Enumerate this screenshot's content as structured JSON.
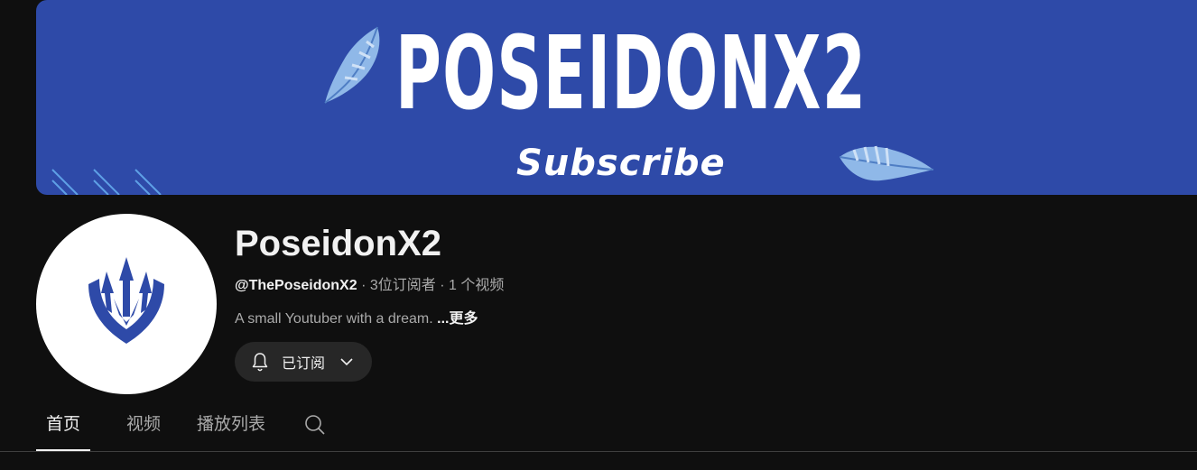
{
  "banner": {
    "title": "POSEIDONX2",
    "subtitle": "Subscribe",
    "background_color": "#2e4aa8"
  },
  "avatar": {
    "icon": "trident-crest-icon",
    "color": "#2e4aa8"
  },
  "channel": {
    "name": "PoseidonX2",
    "handle": "@ThePoseidonX2",
    "separator": " · ",
    "subscribers": "3位订阅者",
    "videos": "1 个视频",
    "description": "A small Youtuber with a dream. ",
    "more_label": "...更多"
  },
  "subscribe_button": {
    "label": "已订阅",
    "icon": "bell-icon",
    "dropdown_icon": "chevron-down-icon"
  },
  "tabs": [
    {
      "label": "首页",
      "active": true
    },
    {
      "label": "视频",
      "active": false
    },
    {
      "label": "播放列表",
      "active": false
    }
  ],
  "search_icon": "search-icon"
}
